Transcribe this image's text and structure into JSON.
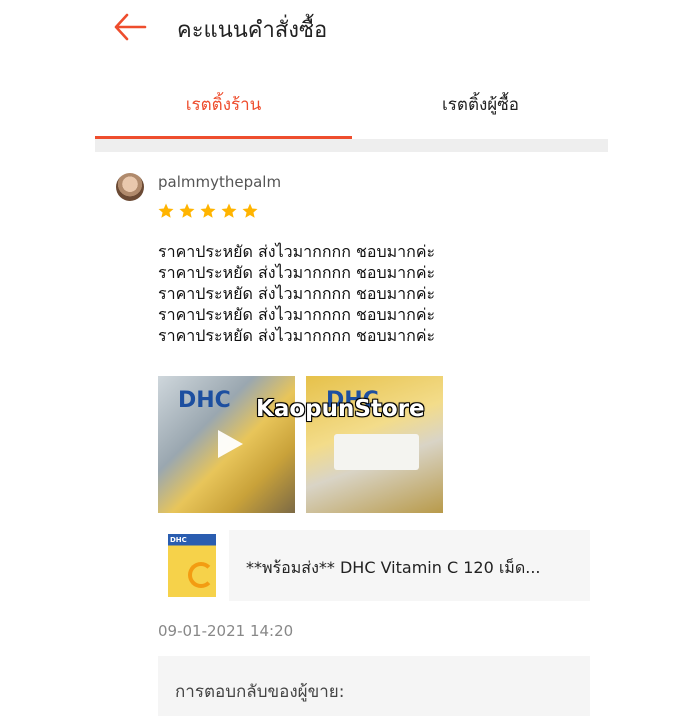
{
  "header": {
    "title": "คะแนนคำสั่งซื้อ"
  },
  "tabs": [
    {
      "label": "เรตติ้งร้าน",
      "active": true
    },
    {
      "label": "เรตติ้งผู้ซื้อ",
      "active": false
    }
  ],
  "review": {
    "username": "palmmythepalm",
    "rating": 5,
    "text_lines": [
      "ราคาประหยัด ส่งไวมากกกก ชอบมากค่ะ",
      "ราคาประหยัด ส่งไวมากกกก ชอบมากค่ะ",
      "ราคาประหยัด ส่งไวมากกกก ชอบมากค่ะ",
      "ราคาประหยัด ส่งไวมากกกก ชอบมากค่ะ",
      "ราคาประหยัด ส่งไวมากกกก ชอบมากค่ะ"
    ],
    "watermark": "KaopunStore",
    "product_name": "**พร้อมส่ง** DHC Vitamin C 120 เม็ด...",
    "timestamp": "09-01-2021 14:20",
    "seller_reply_label": "การตอบกลับของผู้ขาย:"
  },
  "icons": {
    "back": "arrow-left-icon",
    "star": "star-icon",
    "play": "play-icon"
  },
  "colors": {
    "accent": "#ee4d2d",
    "star": "#ffb400"
  }
}
